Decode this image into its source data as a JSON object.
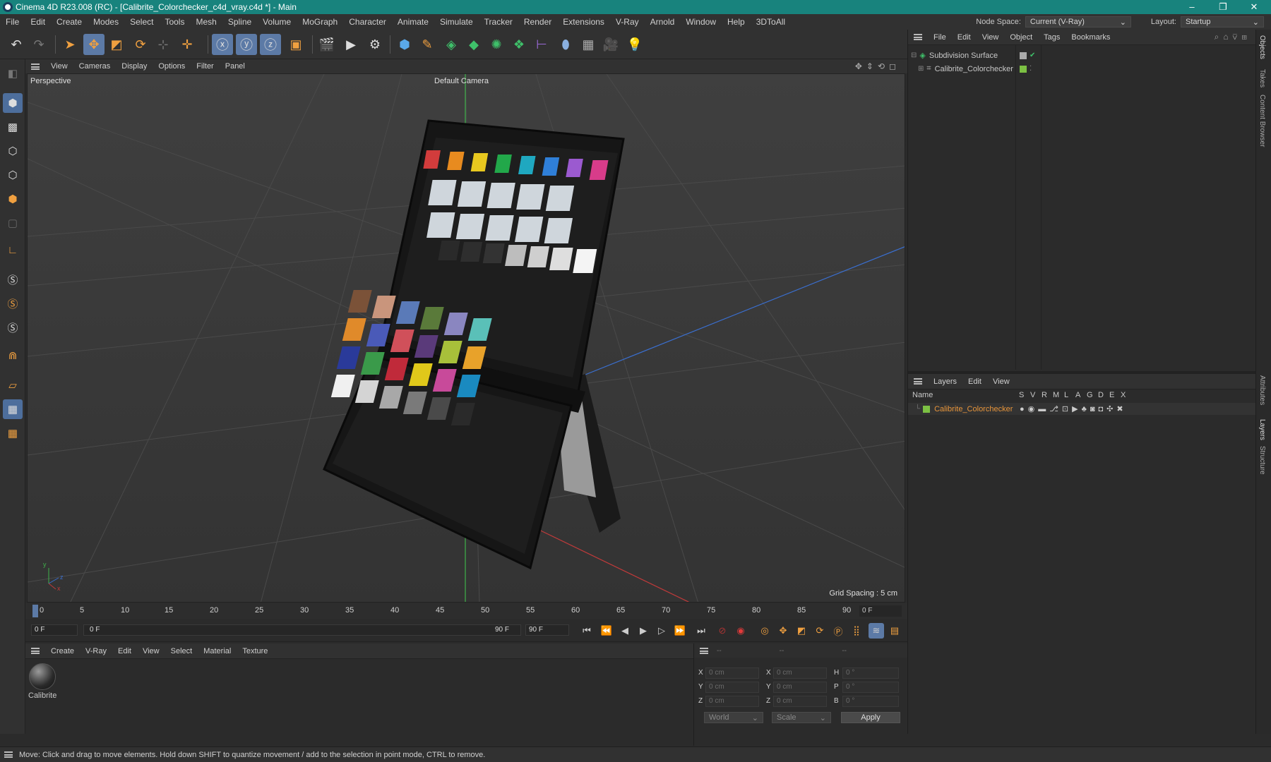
{
  "window": {
    "title": "Cinema 4D R23.008 (RC) - [Calibrite_Colorchecker_c4d_vray.c4d *] - Main",
    "minimize": "–",
    "maximize": "❐",
    "close": "✕"
  },
  "menu": [
    "File",
    "Edit",
    "Create",
    "Modes",
    "Select",
    "Tools",
    "Mesh",
    "Spline",
    "Volume",
    "MoGraph",
    "Character",
    "Animate",
    "Simulate",
    "Tracker",
    "Render",
    "Extensions",
    "V-Ray",
    "Arnold",
    "Window",
    "Help",
    "3DToAll"
  ],
  "node_space": {
    "label": "Node Space:",
    "value": "Current (V-Ray)"
  },
  "layout": {
    "label": "Layout:",
    "value": "Startup"
  },
  "viewport": {
    "menu": [
      "View",
      "Cameras",
      "Display",
      "Options",
      "Filter",
      "Panel"
    ],
    "view_name": "Perspective",
    "camera": "Default Camera",
    "grid_spacing": "Grid Spacing : 5 cm",
    "axis_x": "x",
    "axis_y": "y",
    "axis_z": "z"
  },
  "timeline": {
    "ticks": [
      "0",
      "5",
      "10",
      "15",
      "20",
      "25",
      "30",
      "35",
      "40",
      "45",
      "50",
      "55",
      "60",
      "65",
      "70",
      "75",
      "80",
      "85",
      "90"
    ],
    "current_frame": "0 F"
  },
  "transport": {
    "start": "0 F",
    "range_start": "0 F",
    "range_end": "90 F",
    "end": "90 F"
  },
  "material_panel": {
    "menu": [
      "Create",
      "V-Ray",
      "Edit",
      "View",
      "Select",
      "Material",
      "Texture"
    ],
    "materials": [
      {
        "name": "Calibrite"
      }
    ]
  },
  "coords": {
    "header": [
      "--",
      "--",
      "--"
    ],
    "rows": [
      {
        "a": "X",
        "av": "0 cm",
        "b": "X",
        "bv": "0 cm",
        "c": "H",
        "cv": "0 °"
      },
      {
        "a": "Y",
        "av": "0 cm",
        "b": "Y",
        "bv": "0 cm",
        "c": "P",
        "cv": "0 °"
      },
      {
        "a": "Z",
        "av": "0 cm",
        "b": "Z",
        "bv": "0 cm",
        "c": "B",
        "cv": "0 °"
      }
    ],
    "space": "World",
    "mode": "Scale",
    "apply": "Apply"
  },
  "objects_panel": {
    "menu": [
      "File",
      "Edit",
      "View",
      "Object",
      "Tags",
      "Bookmarks"
    ],
    "items": [
      {
        "name": "Subdivision Surface"
      },
      {
        "name": "Calibrite_Colorchecker"
      }
    ]
  },
  "layers_panel": {
    "menu": [
      "Layers",
      "Edit",
      "View"
    ],
    "columns": [
      "Name",
      "S",
      "V",
      "R",
      "M",
      "L",
      "A",
      "G",
      "D",
      "E",
      "X"
    ],
    "items": [
      {
        "name": "Calibrite_Colorchecker",
        "color": "#7cc043"
      }
    ]
  },
  "side_tabs": [
    "Objects",
    "Takes",
    "Content Browser",
    "Attributes",
    "Layers",
    "Structure"
  ],
  "status": "Move: Click and drag to move elements. Hold down SHIFT to quantize movement / add to the selection in point mode, CTRL to remove.",
  "colors": {
    "title_bar": "#18837d",
    "selection": "#5c7aa6",
    "layer_highlight": "#e8953a"
  }
}
